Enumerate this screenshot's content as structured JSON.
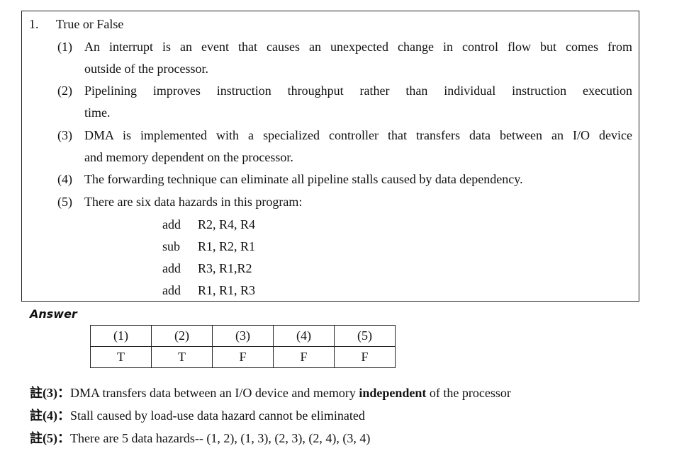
{
  "question": {
    "number": "1.",
    "title": "True or False",
    "items": [
      {
        "num": "(1)",
        "line1": "An interrupt is an event that causes an unexpected change in control flow but comes from",
        "line2": "outside of the processor."
      },
      {
        "num": "(2)",
        "line1": "Pipelining improves instruction throughput rather than individual instruction execution",
        "line2": "time."
      },
      {
        "num": "(3)",
        "line1": "DMA is implemented with a specialized controller that transfers data between an I/O device",
        "line2": "and memory dependent on the processor."
      },
      {
        "num": "(4)",
        "line1": "The forwarding technique can eliminate all pipeline stalls caused by data dependency."
      },
      {
        "num": "(5)",
        "line1": "There are six data hazards in this program:"
      }
    ],
    "code": [
      {
        "op": "add",
        "args": "R2, R4, R4"
      },
      {
        "op": "sub",
        "args": "R1, R2, R1"
      },
      {
        "op": "add",
        "args": "R3, R1,R2"
      },
      {
        "op": "add",
        "args": "R1, R1, R3"
      }
    ]
  },
  "answer": {
    "heading": "Answer",
    "headers": [
      "(1)",
      "(2)",
      "(3)",
      "(4)",
      "(5)"
    ],
    "values": [
      "T",
      "T",
      "F",
      "F",
      "F"
    ]
  },
  "notes": [
    {
      "tag": "註(3)：",
      "pre": "DMA transfers data between an I/O device and memory ",
      "emph": "independent",
      "post": " of the processor"
    },
    {
      "tag": "註(4)：",
      "pre": "Stall caused by load-use data hazard cannot be eliminated",
      "emph": "",
      "post": ""
    },
    {
      "tag": "註(5)：",
      "pre": "There are 5 data hazards-- (1, 2), (1, 3), (2, 3), (2, 4), (3, 4)",
      "emph": "",
      "post": ""
    }
  ]
}
